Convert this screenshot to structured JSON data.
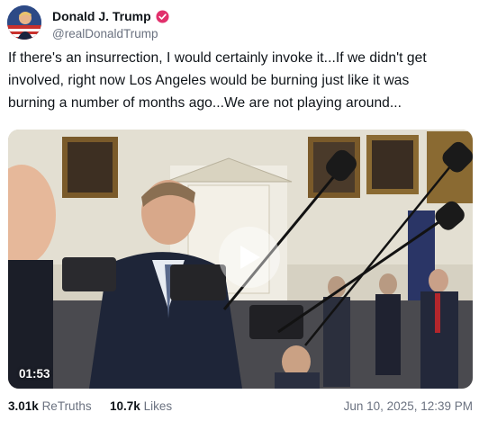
{
  "author": {
    "display_name": "Donald J. Trump",
    "handle": "@realDonaldTrump",
    "verified_icon": "verified-badge-icon"
  },
  "post": {
    "text_lines": [
      "If there's an insurrection, I would certainly invoke it...If we didn't get",
      "involved, right now Los Angeles would be burning just like it was",
      "burning a number of months ago...We are not playing around..."
    ]
  },
  "media": {
    "type": "video",
    "duration": "01:53",
    "play_icon": "play-icon"
  },
  "stats": {
    "retruths_count": "3.01k",
    "retruths_label": "ReTruths",
    "likes_count": "10.7k",
    "likes_label": "Likes",
    "timestamp": "Jun 10, 2025, 12:39 PM"
  },
  "colors": {
    "verified": "#e1306c",
    "text": "#0f1419",
    "muted": "#6b7280"
  }
}
